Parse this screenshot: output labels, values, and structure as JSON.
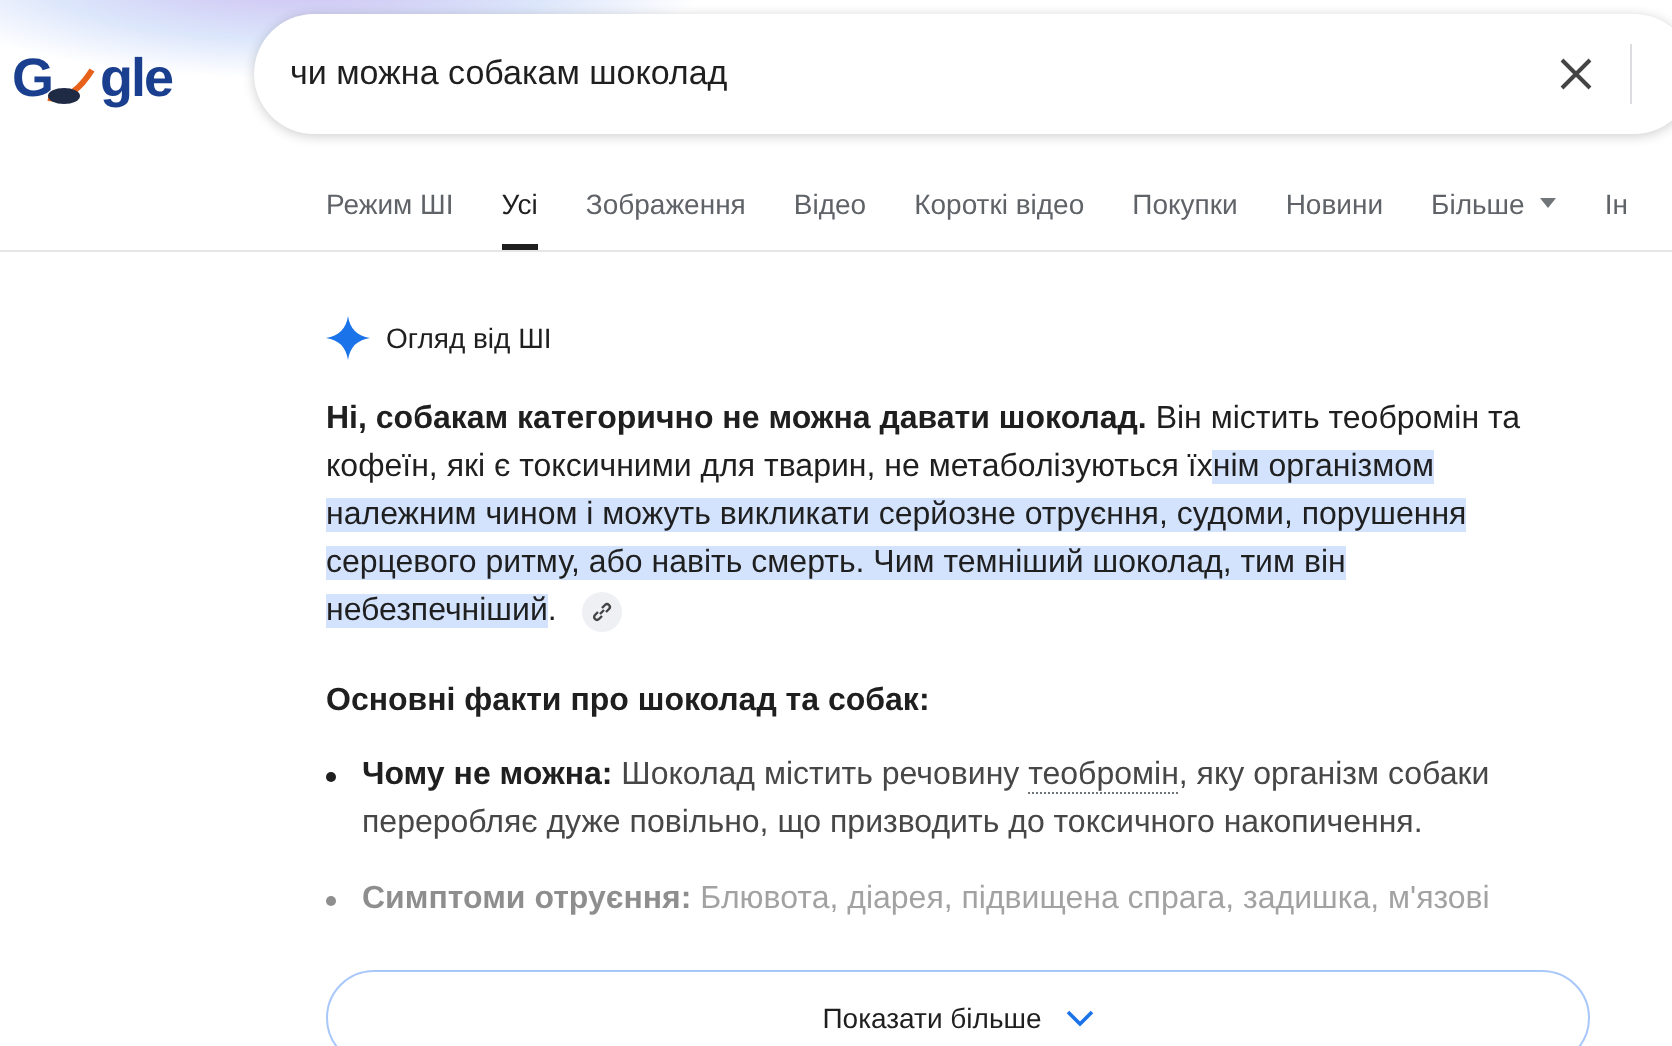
{
  "logo": {
    "left": "G",
    "right": "gle"
  },
  "search": {
    "value": "чи можна собакам шоколад"
  },
  "tabs": [
    {
      "label": "Режим ШІ",
      "selected": false,
      "kind": "plain"
    },
    {
      "label": "Усі",
      "selected": true,
      "kind": "plain"
    },
    {
      "label": "Зображення",
      "selected": false,
      "kind": "plain"
    },
    {
      "label": "Відео",
      "selected": false,
      "kind": "plain"
    },
    {
      "label": "Короткі відео",
      "selected": false,
      "kind": "plain"
    },
    {
      "label": "Покупки",
      "selected": false,
      "kind": "plain"
    },
    {
      "label": "Новини",
      "selected": false,
      "kind": "plain"
    },
    {
      "label": "Більше",
      "selected": false,
      "kind": "menu"
    },
    {
      "label": "Ін",
      "selected": false,
      "kind": "plain"
    }
  ],
  "ai_overview": {
    "title": "Огляд від ШІ",
    "paragraph": [
      {
        "text": "**Ні, собакам категорично не можна давати шоколад.** Він містить теобромін та кофеїн, які є токсичними для тварин, не метаболізуються їх",
        "highlighted": false
      },
      {
        "text": "нім організмом належним чином і можуть викликати серйозне отруєння, судоми, порушення серцевого ритму, або навіть смерть. Чим темніший шоколад, тим він небезпечніший",
        "highlighted": true
      },
      {
        "text": ".",
        "highlighted": false
      }
    ],
    "heading": "Основні факти про шоколад та собак:",
    "bullets": [
      {
        "label": "Чому не можна:",
        "before": "Шоколад містить речовину",
        "term": "теобромін",
        "after": ", яку організм собаки переробляє дуже повільно, що призводить до токсичного накопичення.",
        "faded": false
      },
      {
        "label": "Симптоми отруєння:",
        "before": "Блювота, діарея, підвищена спрага, задишка, м'язові",
        "faded": true
      }
    ],
    "show_more": "Показати більше"
  }
}
